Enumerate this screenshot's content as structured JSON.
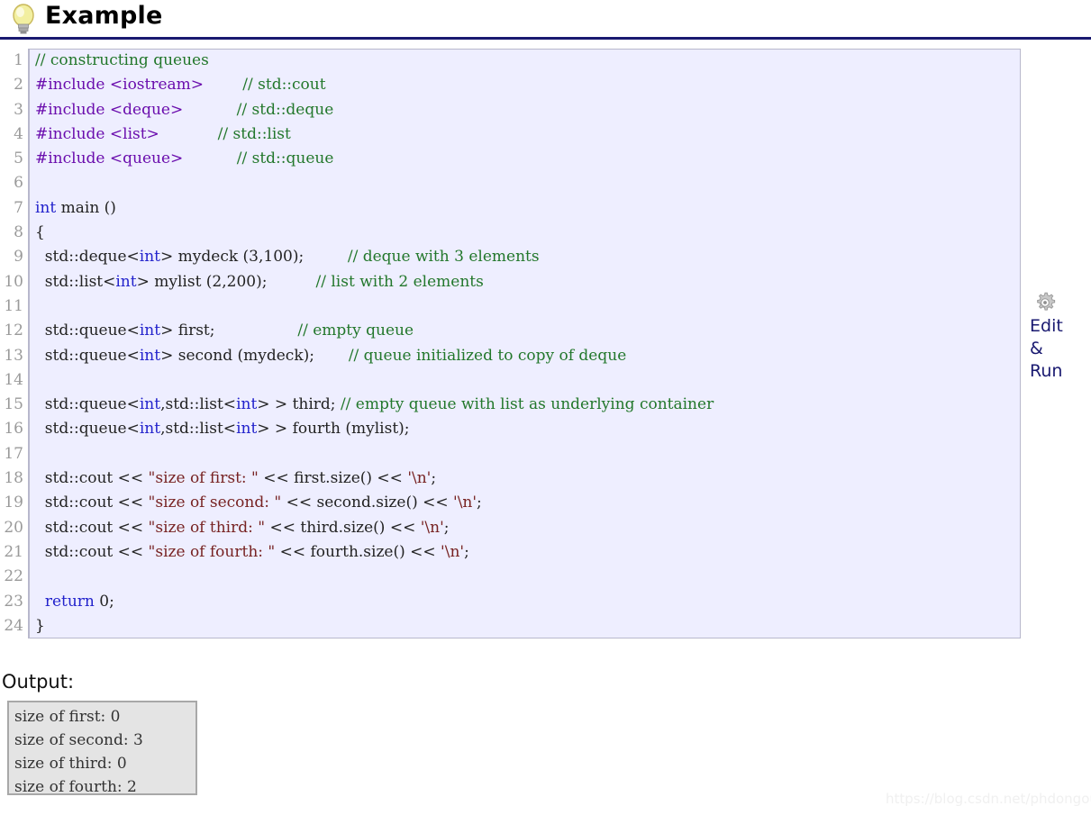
{
  "header": {
    "title": "Example",
    "bulb_icon": "lightbulb-icon",
    "rule_color": "#191970"
  },
  "code": {
    "language": "cpp",
    "background": "#eeeeff",
    "border_color": "#b8b8cc",
    "line_numbers": [
      "1",
      "2",
      "3",
      "4",
      "5",
      "6",
      "7",
      "8",
      "9",
      "10",
      "11",
      "12",
      "13",
      "14",
      "15",
      "16",
      "17",
      "18",
      "19",
      "20",
      "21",
      "22",
      "23",
      "24"
    ],
    "lines": [
      [
        {
          "t": "// constructing queues",
          "c": "cmt"
        }
      ],
      [
        {
          "t": "#include <iostream>",
          "c": "pre"
        },
        {
          "t": "        ",
          "c": "pun"
        },
        {
          "t": "// std::cout",
          "c": "cmt"
        }
      ],
      [
        {
          "t": "#include <deque>",
          "c": "pre"
        },
        {
          "t": "           ",
          "c": "pun"
        },
        {
          "t": "// std::deque",
          "c": "cmt"
        }
      ],
      [
        {
          "t": "#include <list>",
          "c": "pre"
        },
        {
          "t": "            ",
          "c": "pun"
        },
        {
          "t": "// std::list",
          "c": "cmt"
        }
      ],
      [
        {
          "t": "#include <queue>",
          "c": "pre"
        },
        {
          "t": "           ",
          "c": "pun"
        },
        {
          "t": "// std::queue",
          "c": "cmt"
        }
      ],
      [],
      [
        {
          "t": "int",
          "c": "kw"
        },
        {
          "t": " main ()",
          "c": "pun"
        }
      ],
      [
        {
          "t": "{",
          "c": "pun"
        }
      ],
      [
        {
          "t": "  std::deque<",
          "c": "pun"
        },
        {
          "t": "int",
          "c": "kw"
        },
        {
          "t": "> mydeck (3,100);",
          "c": "pun"
        },
        {
          "t": "         ",
          "c": "pun"
        },
        {
          "t": "// deque with 3 elements",
          "c": "cmt"
        }
      ],
      [
        {
          "t": "  std::list<",
          "c": "pun"
        },
        {
          "t": "int",
          "c": "kw"
        },
        {
          "t": "> mylist (2,200);",
          "c": "pun"
        },
        {
          "t": "          ",
          "c": "pun"
        },
        {
          "t": "// list with 2 elements",
          "c": "cmt"
        }
      ],
      [],
      [
        {
          "t": "  std::queue<",
          "c": "pun"
        },
        {
          "t": "int",
          "c": "kw"
        },
        {
          "t": "> first;",
          "c": "pun"
        },
        {
          "t": "                 ",
          "c": "pun"
        },
        {
          "t": "// empty queue",
          "c": "cmt"
        }
      ],
      [
        {
          "t": "  std::queue<",
          "c": "pun"
        },
        {
          "t": "int",
          "c": "kw"
        },
        {
          "t": "> second (mydeck);",
          "c": "pun"
        },
        {
          "t": "       ",
          "c": "pun"
        },
        {
          "t": "// queue initialized to copy of deque",
          "c": "cmt"
        }
      ],
      [],
      [
        {
          "t": "  std::queue<",
          "c": "pun"
        },
        {
          "t": "int",
          "c": "kw"
        },
        {
          "t": ",std::list<",
          "c": "pun"
        },
        {
          "t": "int",
          "c": "kw"
        },
        {
          "t": "> > third; ",
          "c": "pun"
        },
        {
          "t": "// empty queue with list as underlying container",
          "c": "cmt"
        }
      ],
      [
        {
          "t": "  std::queue<",
          "c": "pun"
        },
        {
          "t": "int",
          "c": "kw"
        },
        {
          "t": ",std::list<",
          "c": "pun"
        },
        {
          "t": "int",
          "c": "kw"
        },
        {
          "t": "> > fourth (mylist);",
          "c": "pun"
        }
      ],
      [],
      [
        {
          "t": "  std::cout << ",
          "c": "pun"
        },
        {
          "t": "\"size of first: \"",
          "c": "str"
        },
        {
          "t": " << first.size() << ",
          "c": "pun"
        },
        {
          "t": "'\\n'",
          "c": "str"
        },
        {
          "t": ";",
          "c": "pun"
        }
      ],
      [
        {
          "t": "  std::cout << ",
          "c": "pun"
        },
        {
          "t": "\"size of second: \"",
          "c": "str"
        },
        {
          "t": " << second.size() << ",
          "c": "pun"
        },
        {
          "t": "'\\n'",
          "c": "str"
        },
        {
          "t": ";",
          "c": "pun"
        }
      ],
      [
        {
          "t": "  std::cout << ",
          "c": "pun"
        },
        {
          "t": "\"size of third: \"",
          "c": "str"
        },
        {
          "t": " << third.size() << ",
          "c": "pun"
        },
        {
          "t": "'\\n'",
          "c": "str"
        },
        {
          "t": ";",
          "c": "pun"
        }
      ],
      [
        {
          "t": "  std::cout << ",
          "c": "pun"
        },
        {
          "t": "\"size of fourth: \"",
          "c": "str"
        },
        {
          "t": " << fourth.size() << ",
          "c": "pun"
        },
        {
          "t": "'\\n'",
          "c": "str"
        },
        {
          "t": ";",
          "c": "pun"
        }
      ],
      [],
      [
        {
          "t": "  ",
          "c": "pun"
        },
        {
          "t": "return",
          "c": "kw"
        },
        {
          "t": " 0;",
          "c": "pun"
        }
      ],
      [
        {
          "t": "}",
          "c": "pun"
        }
      ]
    ]
  },
  "edit_run": {
    "gear_icon": "gear-icon",
    "lines": [
      "Edit",
      "&",
      "Run"
    ],
    "text_color": "#191970"
  },
  "output": {
    "label": "Output:",
    "lines": [
      "size of first: 0",
      "size of second: 3",
      "size of third: 0",
      "size of fourth: 2"
    ],
    "background": "#e4e4e4",
    "border_color": "#a8a8a8"
  },
  "watermark": {
    "text": "https://blog.csdn.net/phdongou"
  }
}
